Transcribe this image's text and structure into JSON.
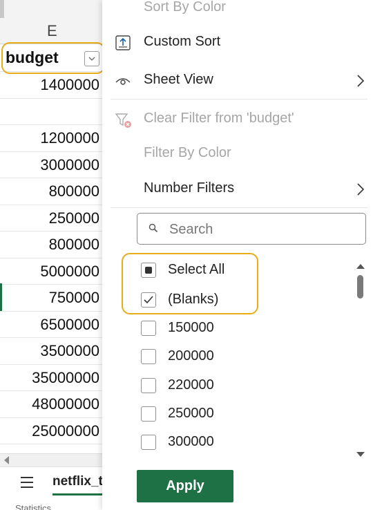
{
  "sheet": {
    "column_letter": "E",
    "header": "budget",
    "rows": [
      "1400000",
      "",
      "1200000",
      "3000000",
      "800000",
      "250000",
      "800000",
      "5000000",
      "750000",
      "6500000",
      "3500000",
      "35000000",
      "48000000",
      "25000000"
    ],
    "sheet_tab": "netflix_t",
    "status": "Statistics"
  },
  "menu": {
    "sort_by_color": "Sort By Color",
    "custom_sort": "Custom Sort",
    "sheet_view": "Sheet View",
    "clear_filter": "Clear Filter from 'budget'",
    "filter_by_color": "Filter By Color",
    "number_filters": "Number Filters",
    "search_placeholder": "Search",
    "items": [
      {
        "label": "Select All",
        "state": "partial"
      },
      {
        "label": "(Blanks)",
        "state": "checked"
      },
      {
        "label": "150000",
        "state": "unchecked"
      },
      {
        "label": "200000",
        "state": "unchecked"
      },
      {
        "label": "220000",
        "state": "unchecked"
      },
      {
        "label": "250000",
        "state": "unchecked"
      },
      {
        "label": "300000",
        "state": "unchecked"
      }
    ],
    "apply": "Apply"
  },
  "colors": {
    "accent_green": "#1e7145",
    "highlight": "#e8ac16",
    "disabled_text": "#a6a6a6"
  }
}
